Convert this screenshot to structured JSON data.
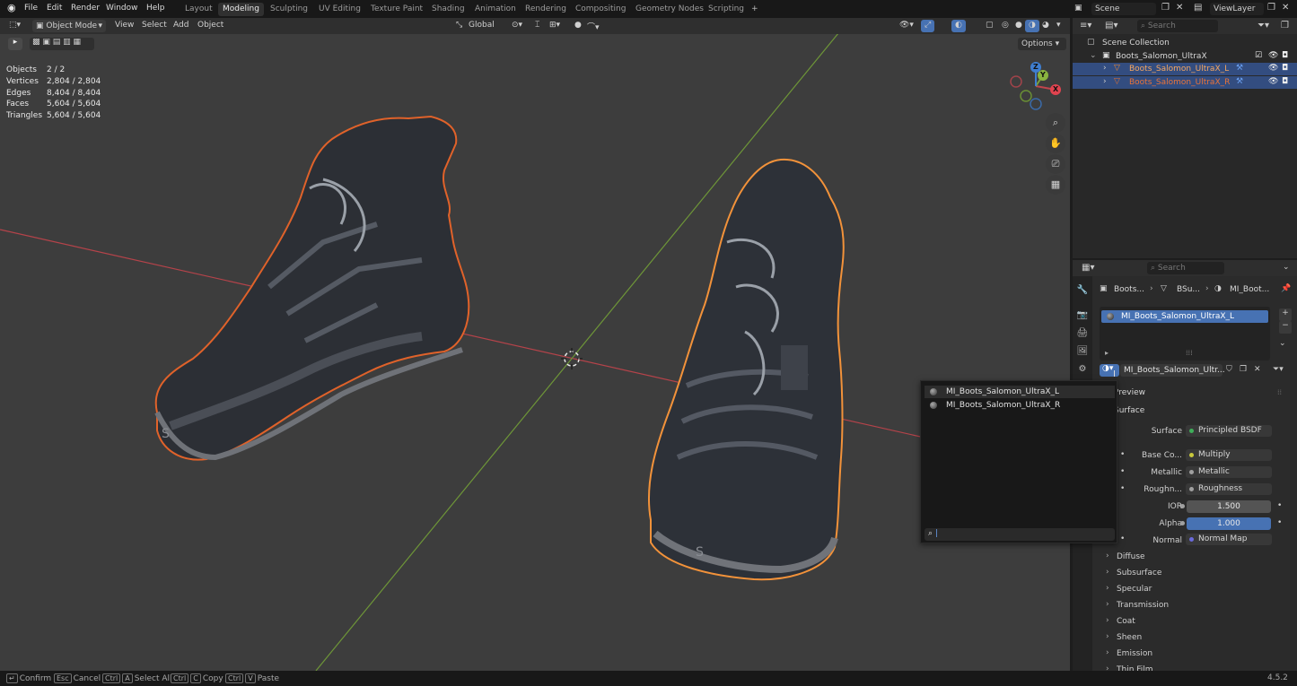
{
  "topbar": {
    "menus": [
      "File",
      "Edit",
      "Render",
      "Window",
      "Help"
    ],
    "workspaces": [
      "Layout",
      "Modeling",
      "Sculpting",
      "UV Editing",
      "Texture Paint",
      "Shading",
      "Animation",
      "Rendering",
      "Compositing",
      "Geometry Nodes",
      "Scripting"
    ],
    "active_workspace": "Modeling",
    "add_tab": "+",
    "scene": "Scene",
    "view_layer": "ViewLayer"
  },
  "viewport_header": {
    "mode": "Object Mode",
    "menus": [
      "View",
      "Select",
      "Add",
      "Object"
    ],
    "transform_orientation": "Global",
    "options": "Options"
  },
  "stats": [
    {
      "label": "Objects",
      "value": "2 / 2"
    },
    {
      "label": "Vertices",
      "value": "2,804 / 2,804"
    },
    {
      "label": "Edges",
      "value": "8,404 / 8,404"
    },
    {
      "label": "Faces",
      "value": "5,604 / 5,604"
    },
    {
      "label": "Triangles",
      "value": "5,604 / 5,604"
    }
  ],
  "gizmo": {
    "x": "X",
    "y": "Y",
    "z": "Z"
  },
  "outliner": {
    "search_placeholder": "Search",
    "root": "Scene Collection",
    "collection": "Boots_Salomon_UltraX",
    "objects": [
      "Boots_Salomon_UltraX_L",
      "Boots_Salomon_UltraX_R"
    ]
  },
  "properties": {
    "search_placeholder": "Search",
    "breadcrumb": [
      "Boots...",
      "BSu...",
      "MI_Boot..."
    ],
    "slot_material": "MI_Boots_Salomon_UltraX_L",
    "material_name": "MI_Boots_Salomon_Ultr...",
    "panels": {
      "preview": "Preview",
      "surface": "Surface"
    },
    "surface_rows": [
      {
        "label": "Surface",
        "value": "Principled BSDF",
        "dot": "#3fae5a"
      },
      {
        "label": "Base Co...",
        "value": "Multiply",
        "dot": "#c8c83c"
      },
      {
        "label": "Metallic",
        "value": "Metallic",
        "dot": "#a0a0a0"
      },
      {
        "label": "Roughn...",
        "value": "Roughness",
        "dot": "#a0a0a0"
      }
    ],
    "ior": {
      "label": "IOR",
      "value": "1.500"
    },
    "alpha": {
      "label": "Alpha",
      "value": "1.000"
    },
    "normal": {
      "label": "Normal",
      "value": "Normal Map",
      "dot": "#6a6adc"
    },
    "sections": [
      "Diffuse",
      "Subsurface",
      "Specular",
      "Transmission",
      "Coat",
      "Sheen",
      "Emission",
      "Thin Film"
    ]
  },
  "dropdown": {
    "items": [
      "MI_Boots_Salomon_UltraX_L",
      "MI_Boots_Salomon_UltraX_R"
    ],
    "search_value": ""
  },
  "statusbar": {
    "hints": [
      {
        "keys": [
          ""
        ],
        "label": "Confirm"
      },
      {
        "keys": [
          "Esc"
        ],
        "label": "Cancel"
      },
      {
        "keys": [
          "Ctrl",
          "A"
        ],
        "label": "Select All"
      },
      {
        "keys": [
          "Ctrl",
          "C"
        ],
        "label": "Copy"
      },
      {
        "keys": [
          "Ctrl",
          "V"
        ],
        "label": "Paste"
      }
    ],
    "version": "4.5.2"
  },
  "colors": {
    "selection_active": "#f08a2e",
    "selection": "#d9591c",
    "x_axis": "#c0454d",
    "y_axis": "#7aa03a",
    "highlight_row": "#334d80",
    "alpha_fill": "#4772b3"
  }
}
